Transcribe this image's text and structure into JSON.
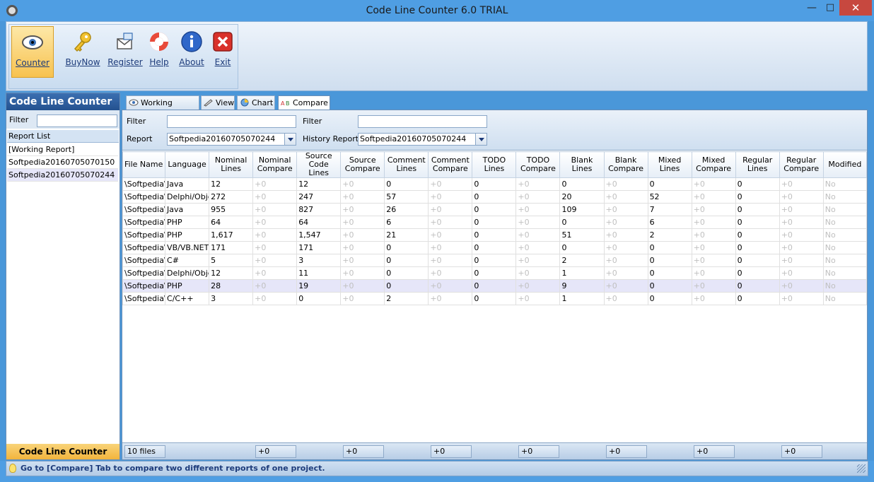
{
  "window": {
    "title": "Code Line Counter 6.0 TRIAL"
  },
  "ribbon": {
    "buttons": [
      {
        "label": "Counter",
        "icon": "eye-icon"
      },
      {
        "label": "BuyNow",
        "icon": "key-icon"
      },
      {
        "label": "Register",
        "icon": "register-icon"
      },
      {
        "label": "Help",
        "icon": "lifebuoy-icon"
      },
      {
        "label": "About",
        "icon": "info-icon"
      },
      {
        "label": "Exit",
        "icon": "close-icon"
      }
    ]
  },
  "leftpanel": {
    "header": "Code Line Counter",
    "filter_label": "Filter",
    "filter_value": "",
    "list_header": "Report List",
    "items": [
      "[Working Report]",
      "Softpedia20160705070150",
      "Softpedia20160705070244"
    ],
    "footer": "Code Line Counter"
  },
  "tabs": [
    "Working Report",
    "View",
    "Chart",
    "Compare"
  ],
  "compare": {
    "filter1_label": "Filter",
    "filter1_value": "",
    "filter2_label": "Filter",
    "filter2_value": "",
    "report_label": "Report",
    "report_value": "Softpedia20160705070244",
    "history_label": "History Report",
    "history_value": "Softpedia20160705070244"
  },
  "table": {
    "columns": [
      "File Name",
      "Language",
      "Nominal Lines",
      "Nominal Compare",
      "Source Code Lines",
      "Source Compare",
      "Comment Lines",
      "Comment Compare",
      "TODO Lines",
      "TODO Compare",
      "Blank Lines",
      "Blank Compare",
      "Mixed Lines",
      "Mixed Compare",
      "Regular Lines",
      "Regular Compare",
      "Modified"
    ],
    "rows": [
      [
        "\\Softpedia\\Softpedia",
        "Java",
        "12",
        "+0",
        "12",
        "+0",
        "0",
        "+0",
        "0",
        "+0",
        "0",
        "+0",
        "0",
        "+0",
        "0",
        "+0",
        "No"
      ],
      [
        "\\Softpedia\\Softpedia",
        "Delphi/Object Pascal",
        "272",
        "+0",
        "247",
        "+0",
        "57",
        "+0",
        "0",
        "+0",
        "20",
        "+0",
        "52",
        "+0",
        "0",
        "+0",
        "No"
      ],
      [
        "\\Softpedia\\Softpedia",
        "Java",
        "955",
        "+0",
        "827",
        "+0",
        "26",
        "+0",
        "0",
        "+0",
        "109",
        "+0",
        "7",
        "+0",
        "0",
        "+0",
        "No"
      ],
      [
        "\\Softpedia\\Softpedia",
        "PHP",
        "64",
        "+0",
        "64",
        "+0",
        "6",
        "+0",
        "0",
        "+0",
        "0",
        "+0",
        "6",
        "+0",
        "0",
        "+0",
        "No"
      ],
      [
        "\\Softpedia\\Softpedia",
        "PHP",
        "1,617",
        "+0",
        "1,547",
        "+0",
        "21",
        "+0",
        "0",
        "+0",
        "51",
        "+0",
        "2",
        "+0",
        "0",
        "+0",
        "No"
      ],
      [
        "\\Softpedia\\Softpedia",
        "VB/VB.NET",
        "171",
        "+0",
        "171",
        "+0",
        "0",
        "+0",
        "0",
        "+0",
        "0",
        "+0",
        "0",
        "+0",
        "0",
        "+0",
        "No"
      ],
      [
        "\\Softpedia\\Softpedia",
        "C#",
        "5",
        "+0",
        "3",
        "+0",
        "0",
        "+0",
        "0",
        "+0",
        "2",
        "+0",
        "0",
        "+0",
        "0",
        "+0",
        "No"
      ],
      [
        "\\Softpedia\\Softpedia",
        "Delphi/Object Pascal",
        "12",
        "+0",
        "11",
        "+0",
        "0",
        "+0",
        "0",
        "+0",
        "1",
        "+0",
        "0",
        "+0",
        "0",
        "+0",
        "No"
      ],
      [
        "\\Softpedia\\Softpedia",
        "PHP",
        "28",
        "+0",
        "19",
        "+0",
        "0",
        "+0",
        "0",
        "+0",
        "9",
        "+0",
        "0",
        "+0",
        "0",
        "+0",
        "No"
      ],
      [
        "\\Softpedia\\Softpedia",
        "C/C++",
        "3",
        "+0",
        "0",
        "+0",
        "2",
        "+0",
        "0",
        "+0",
        "1",
        "+0",
        "0",
        "+0",
        "0",
        "+0",
        "No"
      ]
    ],
    "selected_row": 8,
    "footer": [
      "10 files",
      "+0",
      "+0",
      "+0",
      "+0",
      "+0",
      "+0",
      "+0"
    ]
  },
  "status": {
    "text": "Go to [Compare] Tab to compare two different reports of one project."
  }
}
